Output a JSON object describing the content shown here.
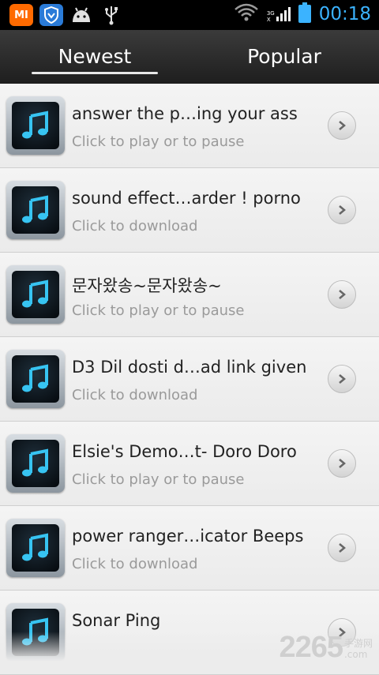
{
  "statusbar": {
    "mi_label": "MI",
    "signal_top": "3G",
    "signal_bottom": "X",
    "time": "00:18",
    "accent": "#3bb3ff"
  },
  "tabs": {
    "newest": "Newest",
    "popular": "Popular",
    "selected": "Newest"
  },
  "list": [
    {
      "title": "answer the p…ing your ass",
      "subtitle": "Click to play or to pause",
      "icon": "music-note-icon"
    },
    {
      "title": "sound effect…arder ! porno",
      "subtitle": "Click to download",
      "icon": "music-note-icon"
    },
    {
      "title": "문자왔송~문자왔송~",
      "subtitle": "Click to play or to pause",
      "icon": "music-note-icon"
    },
    {
      "title": "D3 Dil dosti d…ad link given",
      "subtitle": "Click to download",
      "icon": "music-note-icon"
    },
    {
      "title": "Elsie's Demo…t- Doro Doro",
      "subtitle": "Click to play or to pause",
      "icon": "music-note-icon"
    },
    {
      "title": "power ranger…icator Beeps",
      "subtitle": "Click to download",
      "icon": "music-note-icon"
    },
    {
      "title": "Sonar Ping",
      "subtitle": "",
      "icon": "music-note-icon"
    }
  ],
  "watermark": {
    "number": "2265",
    "side_top": "手游网",
    "side_bottom": ".com"
  }
}
